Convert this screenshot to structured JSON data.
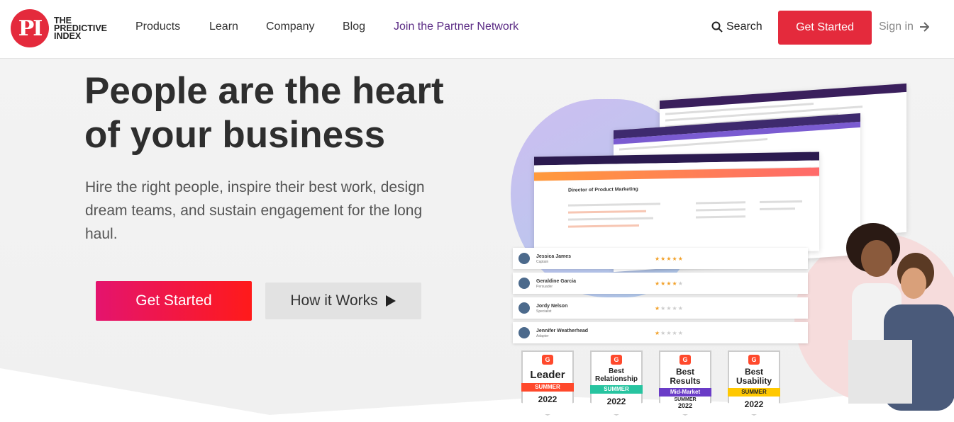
{
  "header": {
    "logo_mark": "PI",
    "logo_lines": [
      "THE",
      "PREDICTIVE",
      "INDEX"
    ],
    "nav": [
      "Products",
      "Learn",
      "Company",
      "Blog",
      "Join the Partner Network"
    ],
    "search_label": "Search",
    "get_started_label": "Get Started",
    "signin_label": "Sign in"
  },
  "hero": {
    "headline_line1": "People are the heart",
    "headline_line2": "of your business",
    "subtext": "Hire the right people, inspire their best work, design dream teams, and sustain engagement for the long haul.",
    "primary_cta": "Get Started",
    "secondary_cta": "How it Works"
  },
  "illustration": {
    "job_title": "Director of Product Marketing",
    "candidates": [
      {
        "name": "Jessica James",
        "role": "Captain",
        "rating": 5
      },
      {
        "name": "Geraldine Garcia",
        "role": "Persuader",
        "rating": 4
      },
      {
        "name": "Jordy Nelson",
        "role": "Specialist",
        "rating": 1.5
      },
      {
        "name": "Jennifer Weatherhead",
        "role": "Adapter",
        "rating": 1
      }
    ],
    "badges": [
      {
        "g": "G",
        "title": "Leader",
        "ribbon": "SUMMER",
        "ribbon_color": "#ff492c",
        "year": "2022"
      },
      {
        "g": "G",
        "title": "Best Relationship",
        "ribbon": "SUMMER",
        "ribbon_color": "#27c4a0",
        "year": "2022"
      },
      {
        "g": "G",
        "title": "Best Results",
        "ribbon": "Mid-Market",
        "ribbon_color": "#6a3cc7",
        "ribbon2": "SUMMER",
        "year": "2022"
      },
      {
        "g": "G",
        "title": "Best Usability",
        "ribbon": "SUMMER",
        "ribbon_color": "#ffc800",
        "year": "2022"
      }
    ]
  },
  "colors": {
    "brand_red": "#e42a3c",
    "partner_purple": "#5a2a84",
    "headline": "#2e2e2e"
  }
}
